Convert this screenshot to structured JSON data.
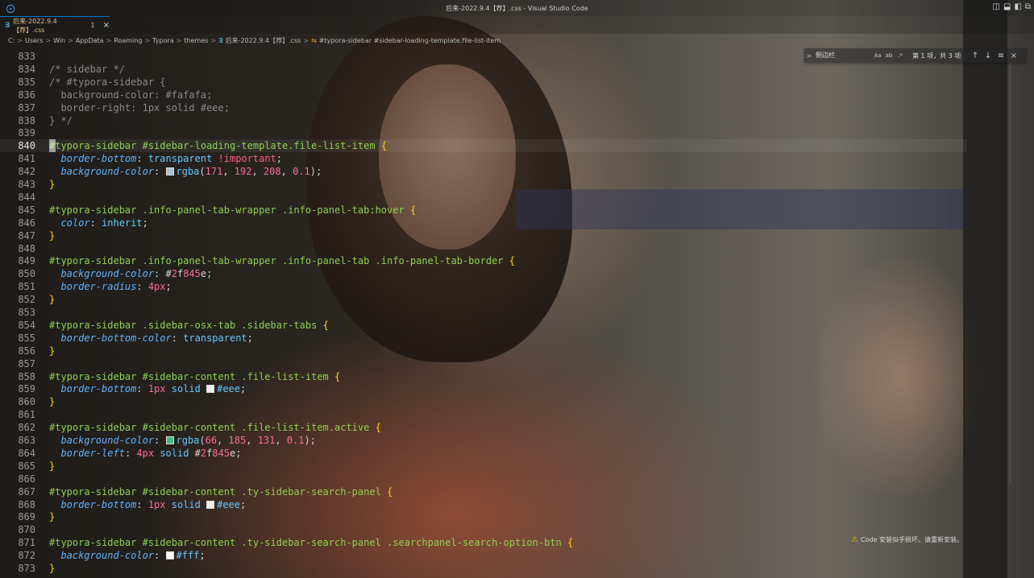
{
  "window": {
    "title": "后来-2022.9.4【荐】.css - Visual Studio Code",
    "app_icon": "vscode-icon",
    "layout_icons": [
      "◫",
      "⬓",
      "◧",
      "⧉"
    ]
  },
  "tab": {
    "label": "后来-2022.9.4【荐】.css",
    "dirty_marker": "1",
    "file_icon": "∃",
    "close": "×"
  },
  "breadcrumb": {
    "items": [
      "C:",
      "Users",
      "Win",
      "AppData",
      "Roaming",
      "Typora",
      "themes",
      "后来-2022.9.4【荐】.css",
      "#typora-sidebar #sidebar-loading-template.file-list-item"
    ],
    "separator": ">"
  },
  "find": {
    "value": "侧边栏",
    "match_case": "Aa",
    "whole_word": "ab",
    "regex": ".*",
    "result": "第 1 项，共 3 项",
    "prev": "↑",
    "next": "↓",
    "selection": "≡",
    "close": "×",
    "toggle": ">"
  },
  "notification": {
    "icon": "⚠",
    "text": "Code 安装似乎损坏。请重新安装。"
  },
  "editor": {
    "current_line": 840,
    "lines": [
      {
        "n": "833",
        "t": ""
      },
      {
        "n": "834",
        "t": "/* sidebar */"
      },
      {
        "n": "835",
        "t": "/* #typora-sidebar {"
      },
      {
        "n": "836",
        "t": "  background-color: #fafafa;"
      },
      {
        "n": "837",
        "t": "  border-right: 1px solid #eee;"
      },
      {
        "n": "838",
        "t": "} */"
      },
      {
        "n": "839",
        "t": ""
      },
      {
        "n": "840",
        "t": "#typora-sidebar #sidebar-loading-template.file-list-item {"
      },
      {
        "n": "841",
        "t": "  border-bottom: transparent !important;"
      },
      {
        "n": "842",
        "t": "  background-color: rgba(171, 192, 208, 0.1);"
      },
      {
        "n": "843",
        "t": "}"
      },
      {
        "n": "844",
        "t": ""
      },
      {
        "n": "845",
        "t": "#typora-sidebar .info-panel-tab-wrapper .info-panel-tab:hover {"
      },
      {
        "n": "846",
        "t": "  color: inherit;"
      },
      {
        "n": "847",
        "t": "}"
      },
      {
        "n": "848",
        "t": ""
      },
      {
        "n": "849",
        "t": "#typora-sidebar .info-panel-tab-wrapper .info-panel-tab .info-panel-tab-border {"
      },
      {
        "n": "850",
        "t": "  background-color: #2f845e;"
      },
      {
        "n": "851",
        "t": "  border-radius: 4px;"
      },
      {
        "n": "852",
        "t": "}"
      },
      {
        "n": "853",
        "t": ""
      },
      {
        "n": "854",
        "t": "#typora-sidebar .sidebar-osx-tab .sidebar-tabs {"
      },
      {
        "n": "855",
        "t": "  border-bottom-color: transparent;"
      },
      {
        "n": "856",
        "t": "}"
      },
      {
        "n": "857",
        "t": ""
      },
      {
        "n": "858",
        "t": "#typora-sidebar #sidebar-content .file-list-item {"
      },
      {
        "n": "859",
        "t": "  border-bottom: 1px solid #eee;"
      },
      {
        "n": "860",
        "t": "}"
      },
      {
        "n": "861",
        "t": ""
      },
      {
        "n": "862",
        "t": "#typora-sidebar #sidebar-content .file-list-item.active {"
      },
      {
        "n": "863",
        "t": "  background-color: rgba(66, 185, 131, 0.1);"
      },
      {
        "n": "864",
        "t": "  border-left: 4px solid #2f845e;"
      },
      {
        "n": "865",
        "t": "}"
      },
      {
        "n": "866",
        "t": ""
      },
      {
        "n": "867",
        "t": "#typora-sidebar #sidebar-content .ty-sidebar-search-panel {"
      },
      {
        "n": "868",
        "t": "  border-bottom: 1px solid #eee;"
      },
      {
        "n": "869",
        "t": "}"
      },
      {
        "n": "870",
        "t": ""
      },
      {
        "n": "871",
        "t": "#typora-sidebar #sidebar-content .ty-sidebar-search-panel .searchpanel-search-option-btn {"
      },
      {
        "n": "872",
        "t": "  background-color: #fff;"
      },
      {
        "n": "873",
        "t": "}"
      }
    ],
    "swatches": {
      "842": "#abc0d0",
      "850": "#2f845e",
      "859": "#eeeeee",
      "863": "#42b983",
      "864": "#2f845e",
      "868": "#eeeeee",
      "872": "#ffffff"
    }
  }
}
